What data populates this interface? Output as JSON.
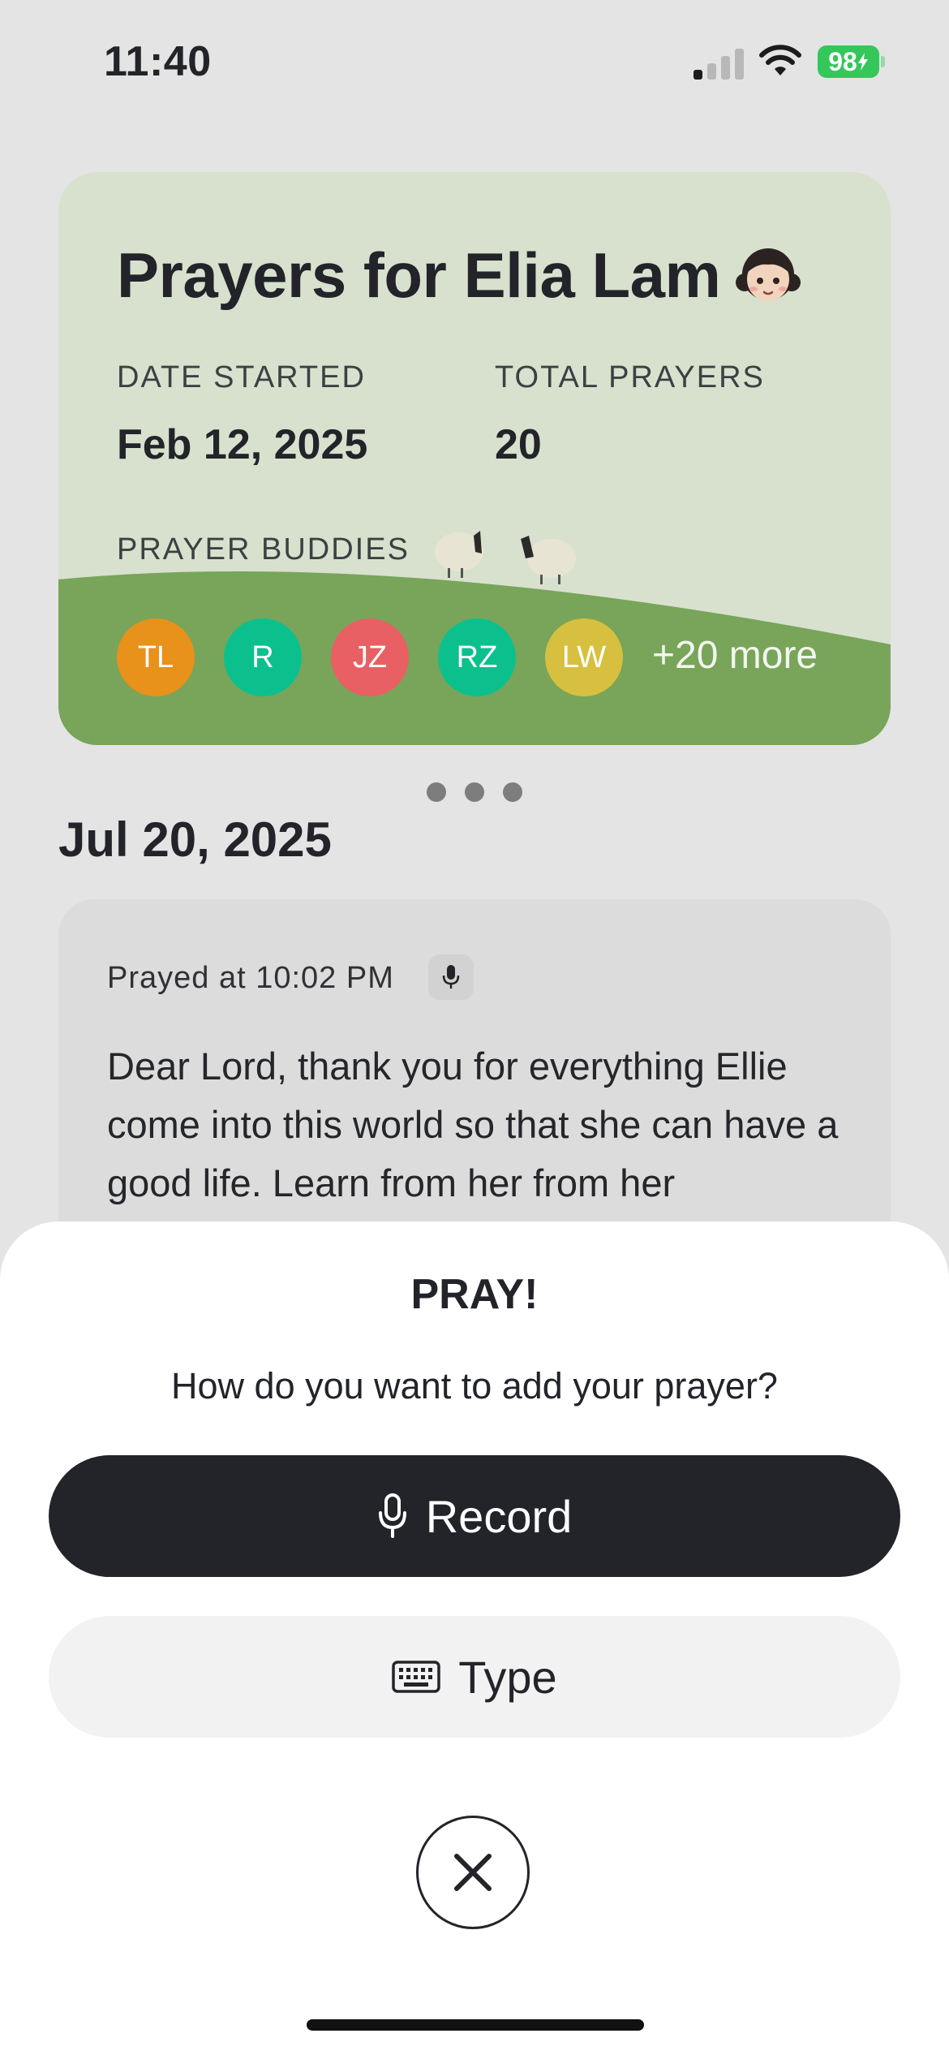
{
  "status_bar": {
    "time": "11:40",
    "battery": "98"
  },
  "card": {
    "title": "Prayers for Elia Lam",
    "emoji_icon": "girl-emoji-icon",
    "date_started_label": "DATE STARTED",
    "date_started_value": "Feb 12, 2025",
    "total_prayers_label": "TOTAL PRAYERS",
    "total_prayers_value": "20",
    "buddies_label": "PRAYER BUDDIES",
    "buddies": [
      {
        "initials": "TL",
        "color": "#e8911b"
      },
      {
        "initials": "R",
        "color": "#0cc08e"
      },
      {
        "initials": "JZ",
        "color": "#e86063"
      },
      {
        "initials": "RZ",
        "color": "#0cc08e"
      },
      {
        "initials": "LW",
        "color": "#d7c03f"
      }
    ],
    "more_buddies": "+20 more",
    "colors": {
      "card_bg": "#d8e1cd",
      "hill": "#78a55a"
    }
  },
  "pager": {
    "page_count": 3,
    "current": 1
  },
  "feed": {
    "date": "Jul 20, 2025",
    "entry": {
      "prayed_at": "Prayed at 10:02 PM",
      "type_icon": "microphone-icon",
      "text": "Dear Lord, thank you for everything Ellie come into this world so that she can have a good life. Learn from her from her"
    }
  },
  "sheet": {
    "title": "PRAY!",
    "question": "How do you want to add your prayer?",
    "record_label": "Record",
    "type_label": "Type",
    "record_icon": "microphone-icon",
    "type_icon": "keyboard-icon",
    "close_icon": "close-icon"
  }
}
